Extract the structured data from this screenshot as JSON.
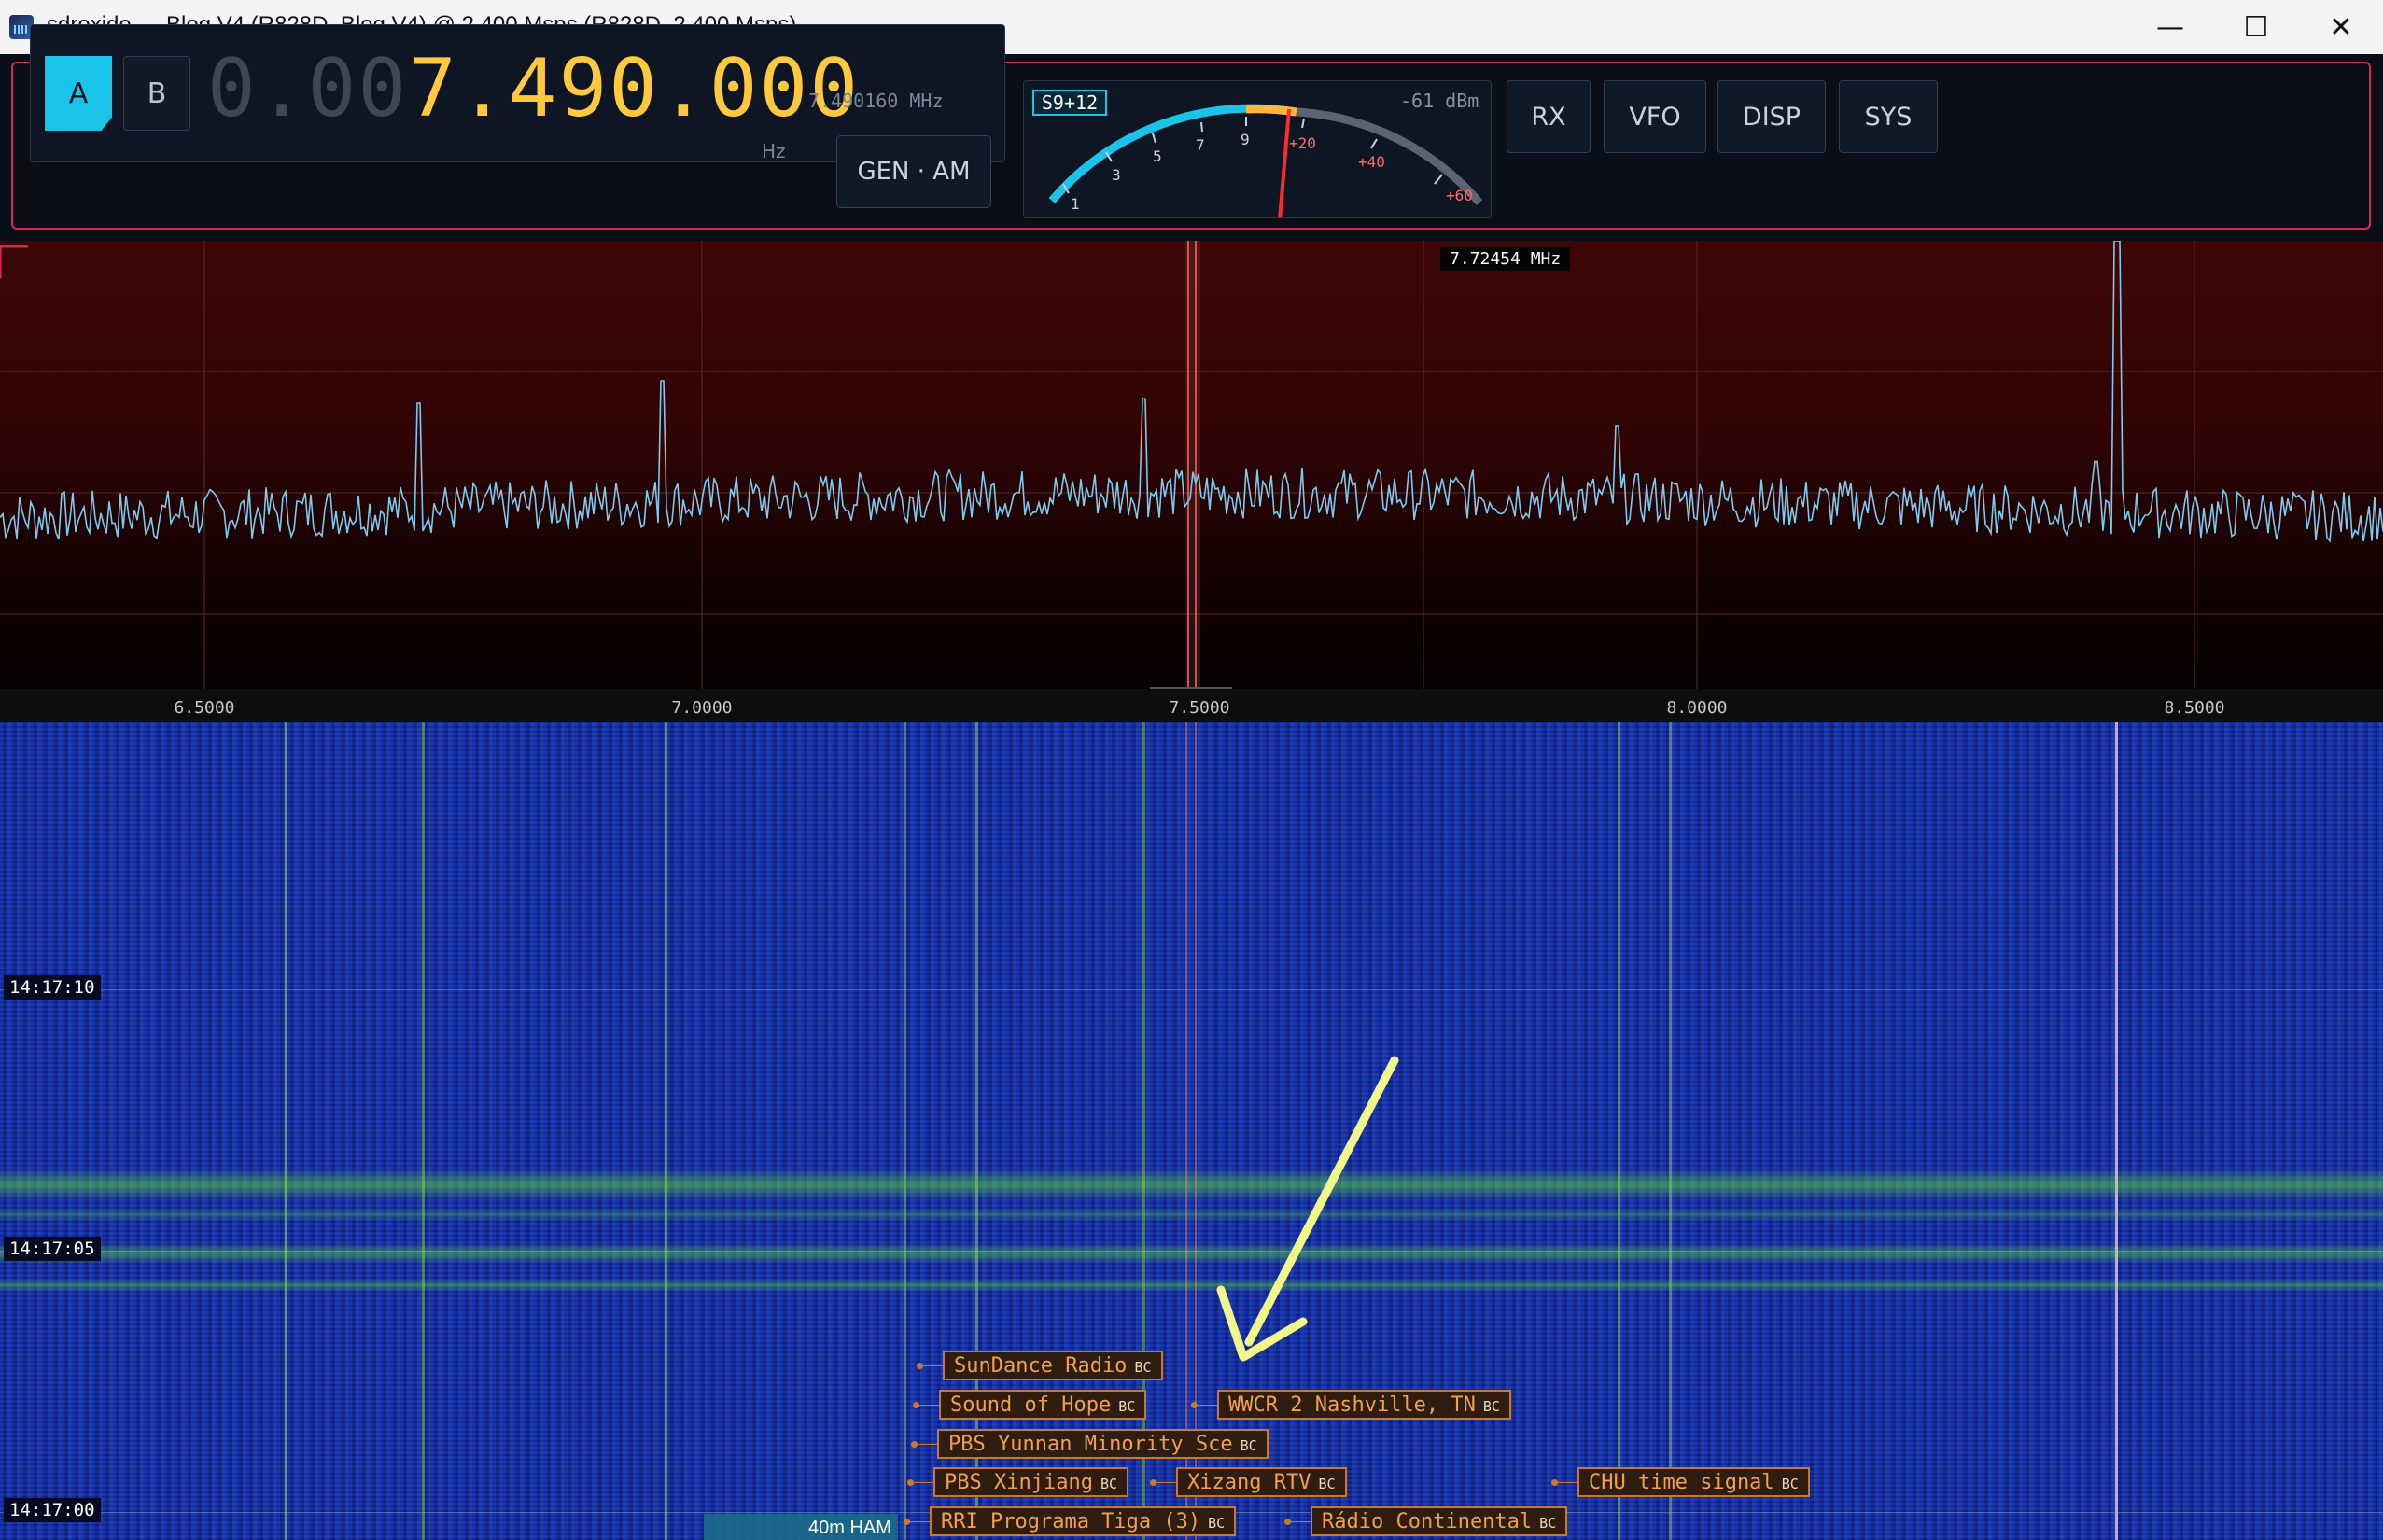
{
  "window": {
    "title": "sdroxide — Blog V4 (R828D, Blog V4) @ 2.400 Msps (R828D, 2.400 Msps)",
    "controls": [
      "—",
      "☐",
      "✕"
    ]
  },
  "vfo": {
    "a_label": "A",
    "b_label": "B",
    "active": "A",
    "freq_lead": "0.00",
    "freq_main": "7.490.000",
    "freq_unit": "Hz",
    "freq_readout": "7.490160 MHz",
    "mode": "GEN · AM"
  },
  "smeter": {
    "badge": "S9+12",
    "dbm": "-61 dBm",
    "scale_s": [
      "1",
      "3",
      "5",
      "7",
      "9"
    ],
    "scale_plus": [
      "+20",
      "+40",
      "+60"
    ],
    "level_fraction": 0.57
  },
  "menu": [
    "RX",
    "VFO",
    "DISP",
    "SYS"
  ],
  "spectrum": {
    "peak_label": "7.72454 MHz",
    "axis_ticks": [
      "6.5000",
      "7.0000",
      "7.5000",
      "8.0000",
      "8.5000"
    ]
  },
  "waterfall": {
    "times": [
      "14:17:10",
      "14:17:05",
      "14:17:00"
    ],
    "band_label": "40m HAM",
    "badge": "BC",
    "stations": [
      "SunDance Radio",
      "Sound of Hope",
      "WWCR 2 Nashville, TN",
      "PBS Yunnan Minority Sce",
      "PBS Xinjiang",
      "Xizang RTV",
      "CHU time signal",
      "RRI Programa Tiga (3)",
      "Rádio Continental"
    ]
  },
  "colors": {
    "accent": "#19c4e8",
    "frequency": "#ffc83d",
    "frame": "#d8284e",
    "trace": "#7fc8ee",
    "station": "#f2a04a",
    "arrow": "#f2f58a"
  }
}
